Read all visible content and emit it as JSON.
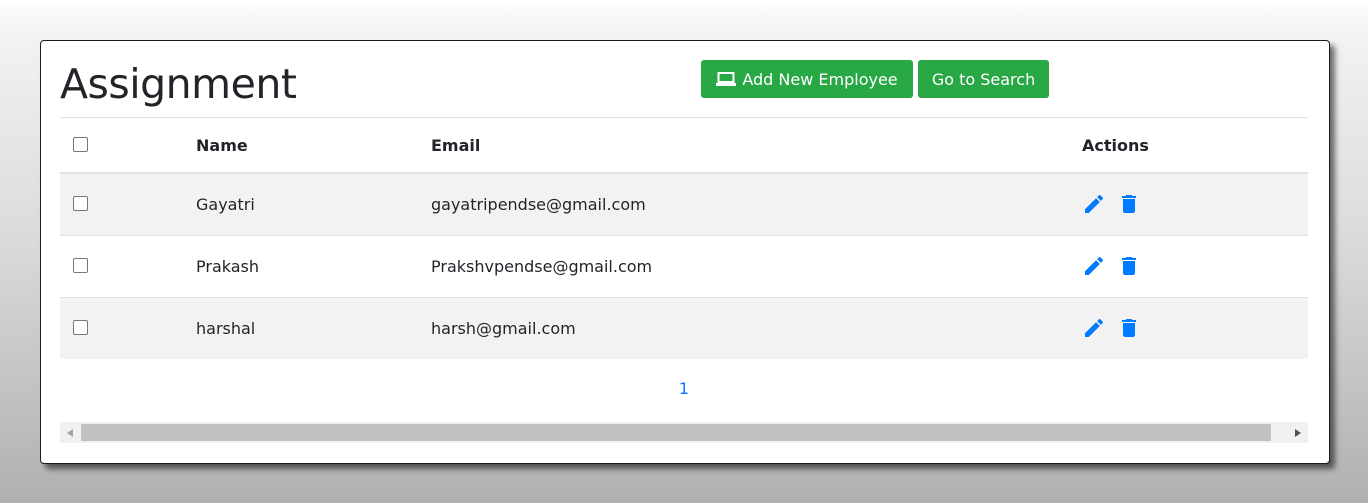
{
  "page": {
    "title": "Assignment"
  },
  "toolbar": {
    "add_label": "Add New Employee",
    "add_icon": "laptop-icon",
    "search_label": "Go to Search",
    "button_color": "#28a745"
  },
  "table": {
    "headers": {
      "name": "Name",
      "email": "Email",
      "actions": "Actions"
    },
    "rows": [
      {
        "name": "Gayatri",
        "email": "gayatripendse@gmail.com"
      },
      {
        "name": "Prakash",
        "email": "Prakshvpendse@gmail.com"
      },
      {
        "name": "harshal",
        "email": "harsh@gmail.com"
      }
    ],
    "action_icons": [
      "edit-icon",
      "delete-icon"
    ],
    "action_color": "#007bff"
  },
  "pagination": {
    "current_page": "1"
  }
}
